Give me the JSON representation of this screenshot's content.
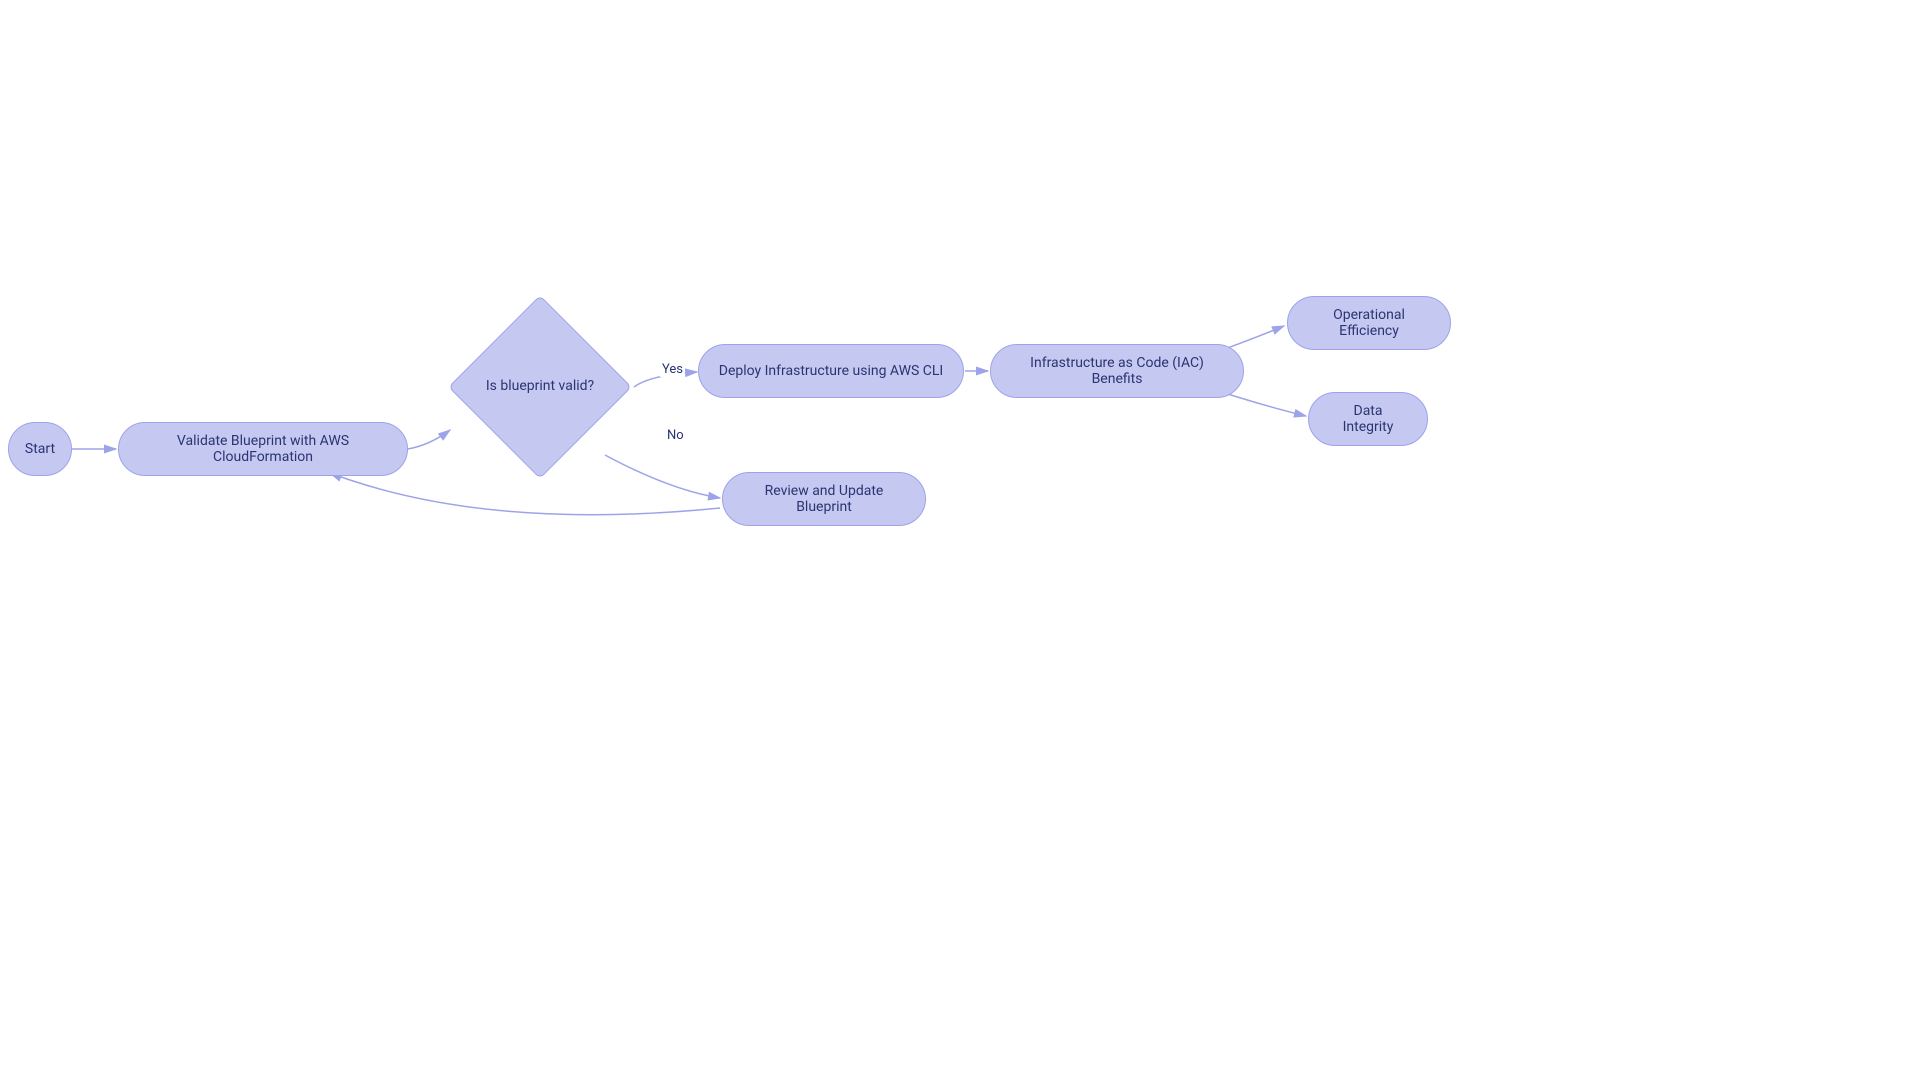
{
  "nodes": {
    "start": "Start",
    "validate": "Validate Blueprint with AWS CloudFormation",
    "decision": "Is blueprint valid?",
    "deploy": "Deploy Infrastructure using AWS CLI",
    "review": "Review and Update Blueprint",
    "iac": "Infrastructure as Code (IAC) Benefits",
    "opeff": "Operational Efficiency",
    "data": "Data Integrity"
  },
  "edges": {
    "yes": "Yes",
    "no": "No"
  }
}
